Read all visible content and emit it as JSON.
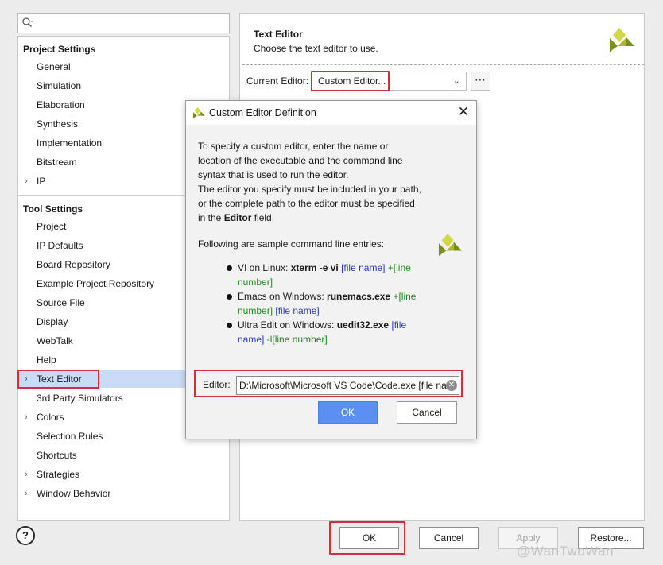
{
  "search": {
    "placeholder": "Q-"
  },
  "tree": {
    "project_settings_title": "Project Settings",
    "project_items": [
      {
        "label": "General"
      },
      {
        "label": "Simulation"
      },
      {
        "label": "Elaboration"
      },
      {
        "label": "Synthesis"
      },
      {
        "label": "Implementation"
      },
      {
        "label": "Bitstream"
      },
      {
        "label": "IP"
      }
    ],
    "tool_settings_title": "Tool Settings",
    "tool_items": [
      {
        "label": "Project"
      },
      {
        "label": "IP Defaults"
      },
      {
        "label": "Board Repository"
      },
      {
        "label": "Example Project Repository"
      },
      {
        "label": "Source File"
      },
      {
        "label": "Display"
      },
      {
        "label": "WebTalk"
      },
      {
        "label": "Help"
      },
      {
        "label": "Text Editor"
      },
      {
        "label": "3rd Party Simulators"
      },
      {
        "label": "Colors"
      },
      {
        "label": "Selection Rules"
      },
      {
        "label": "Shortcuts"
      },
      {
        "label": "Strategies"
      },
      {
        "label": "Window Behavior"
      }
    ]
  },
  "text_editor_page": {
    "title": "Text Editor",
    "subtitle": "Choose the text editor to use.",
    "current_editor_label": "Current Editor:",
    "current_editor_value": "Custom Editor...",
    "more_button_label": "⋯"
  },
  "dialog": {
    "title": "Custom Editor Definition",
    "desc_line1": "To specify a custom editor, enter the name or",
    "desc_line2": "location of the executable and the command line",
    "desc_line3": "syntax that is used to run the editor.",
    "desc_line4": "The editor you specify must be included in your path,",
    "desc_line5": "or the complete path to the editor must be specified",
    "desc_line6_pre": "in the ",
    "desc_line6_bold": "Editor",
    "desc_line6_post": " field.",
    "following": "Following are sample command line entries:",
    "entry1_prefix": "VI on Linux: ",
    "entry1_cmd": "xterm -e vi",
    "entry1_file": "[file name]",
    "entry1_line": "+[line number]",
    "entry2_prefix": "Emacs on Windows: ",
    "entry2_cmd": "runemacs.exe",
    "entry2_line": "+[line number]",
    "entry2_file": "[file name]",
    "entry3_prefix": "Ultra Edit on Windows: ",
    "entry3_cmd": "uedit32.exe",
    "entry3_file": "[file name]",
    "entry3_line": "-l[line number]",
    "editor_label": "Editor:",
    "editor_value": "D:\\Microsoft\\Microsoft VS Code\\Code.exe [file na",
    "ok_label": "OK",
    "cancel_label": "Cancel"
  },
  "footer": {
    "help_label": "?",
    "ok_label": "OK",
    "cancel_label": "Cancel",
    "apply_label": "Apply",
    "restore_label": "Restore...",
    "watermark": "@WanTwoWan"
  },
  "colors": {
    "selection": "#c9dbf7",
    "highlight_box": "#d32f3a",
    "primary_button": "#5b8ff2",
    "logo": "#7a8f1a"
  }
}
